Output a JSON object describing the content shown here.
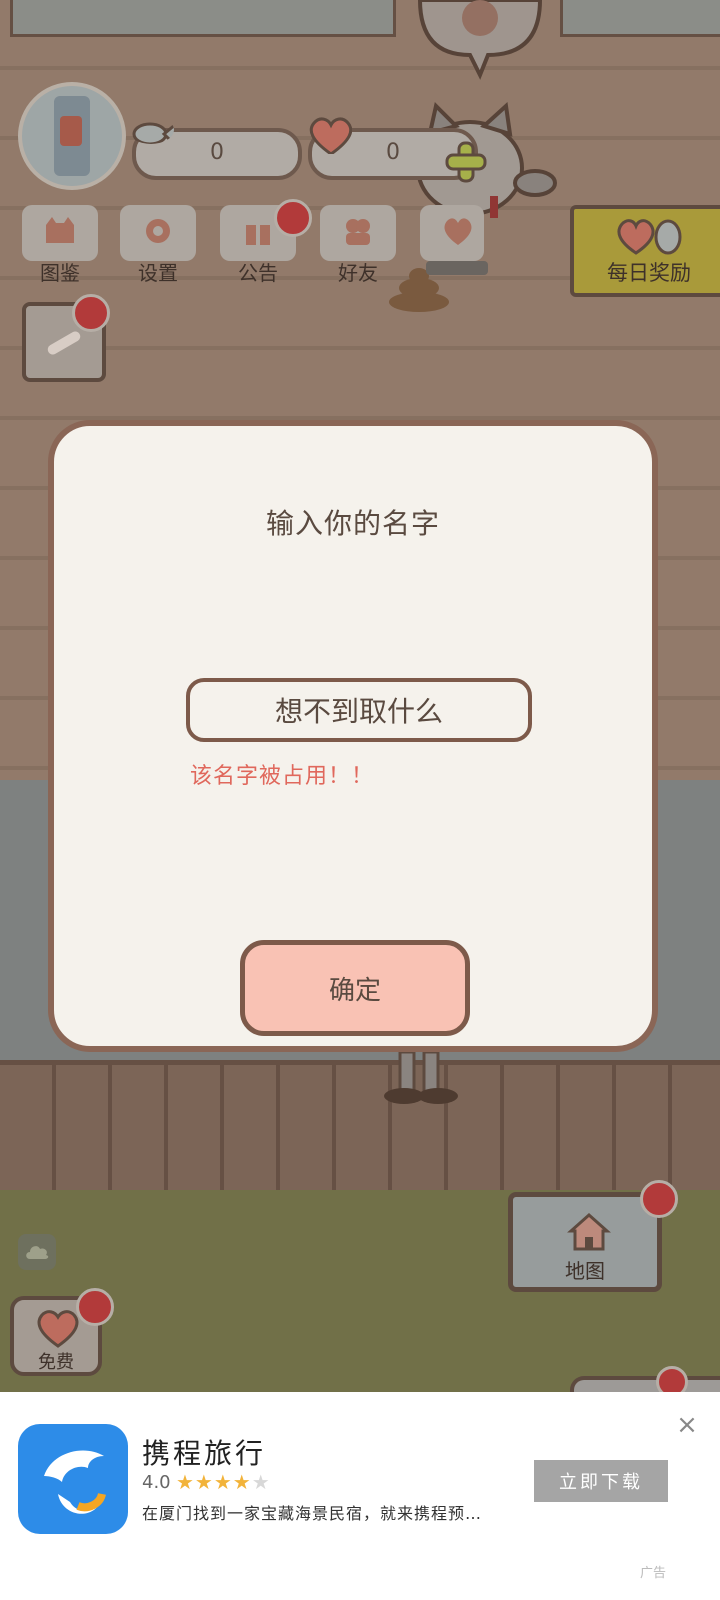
{
  "header": {
    "fish_count": "0",
    "heart_count": "0"
  },
  "menu": [
    {
      "label": "图鉴",
      "icon": "cat-book-icon"
    },
    {
      "label": "设置",
      "icon": "gear-icon"
    },
    {
      "label": "公告",
      "icon": "gift-icon"
    },
    {
      "label": "好友",
      "icon": "friends-icon"
    }
  ],
  "daily_reward": {
    "label": "每日奖励"
  },
  "dialog": {
    "title": "输入你的名字",
    "name_value": "想不到取什么",
    "error": "该名字被占用！！",
    "confirm_label": "确定"
  },
  "map_button": {
    "label": "地图"
  },
  "free_button": {
    "label": "免费"
  },
  "ad": {
    "app_name": "携程旅行",
    "rating": "4.0",
    "stars": "★★★★★",
    "description": "在厦门找到一家宝藏海景民宿，就来携程预…",
    "download_label": "立即下载",
    "close": "×",
    "tag": "广告"
  },
  "colors": {
    "modal_bg": "#f5f2ec",
    "modal_border": "#8a6656",
    "error_text": "#e0685c",
    "confirm_bg": "#f9c2b4",
    "badge": "#b23a3a",
    "ad_logo": "#2d8ce8"
  }
}
